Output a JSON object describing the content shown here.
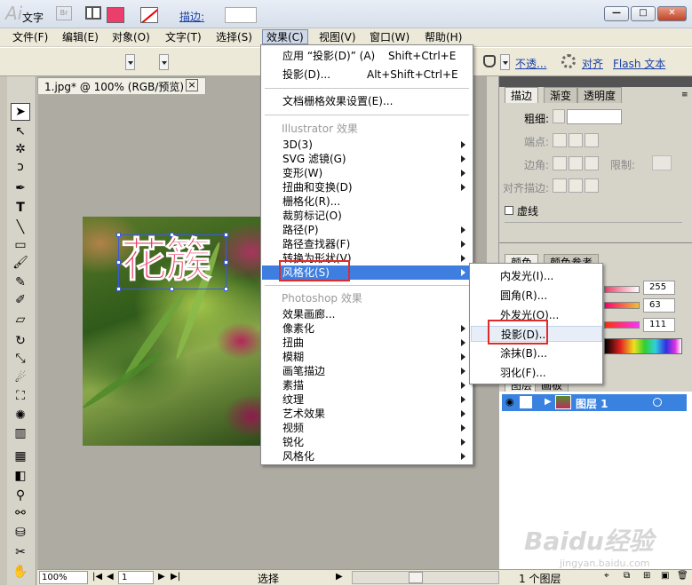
{
  "app": {
    "logo": "Ai",
    "bridge": "Br"
  },
  "window_buttons": {
    "minimize": "—",
    "restore": "□",
    "close": "✕"
  },
  "menubar": [
    "文件(F)",
    "编辑(E)",
    "对象(O)",
    "文字(T)",
    "选择(S)",
    "效果(C)",
    "视图(V)",
    "窗口(W)",
    "帮助(H)"
  ],
  "control_bar": {
    "tool_name": "文字",
    "stroke_label": "描边:",
    "opacity_label": "不透...",
    "align_label": "对齐",
    "flash_text_label": "Flash 文本"
  },
  "colors": {
    "fill": "#ec3e6a",
    "accent": "#3e7ee0",
    "highlight_box": "#e12a2a"
  },
  "document": {
    "tab_title": "1.jpg* @ 100% (RGB/预览)",
    "title_text": "花簇"
  },
  "effect_menu": {
    "apply_item": "应用 “投影(D)” (A)",
    "apply_shortcut": "Shift+Ctrl+E",
    "shadow_item": "投影(D)...",
    "shadow_shortcut": "Alt+Shift+Ctrl+E",
    "raster_settings": "文档栅格效果设置(E)...",
    "illustrator_header": "Illustrator 效果",
    "illustrator_items": [
      "3D(3)",
      "SVG 滤镜(G)",
      "变形(W)",
      "扭曲和变换(D)",
      "栅格化(R)...",
      "裁剪标记(O)",
      "路径(P)",
      "路径查找器(F)",
      "转换为形状(V)",
      "风格化(S)"
    ],
    "photoshop_header": "Photoshop 效果",
    "photoshop_items": [
      "效果画廊...",
      "像素化",
      "扭曲",
      "模糊",
      "画笔描边",
      "素描",
      "纹理",
      "艺术效果",
      "视频",
      "锐化",
      "风格化"
    ]
  },
  "stylize_submenu": [
    "内发光(I)...",
    "圆角(R)...",
    "外发光(O)...",
    "投影(D)...",
    "涂抹(B)...",
    "羽化(F)..."
  ],
  "stroke_panel": {
    "tabs": [
      "描边",
      "渐变",
      "透明度"
    ],
    "weight_label": "粗细:",
    "cap_label": "端点:",
    "corner_label": "边角:",
    "limit_label": "限制:",
    "align_stroke_label": "对齐描边:",
    "dashed_label": "虚线"
  },
  "color_panel": {
    "tabs": [
      "颜色",
      "颜色参考"
    ],
    "values": [
      "255",
      "63",
      "111"
    ]
  },
  "layers_panel": {
    "tabs": [
      "图层",
      "画板"
    ],
    "layer_name": "图层 1",
    "count_label": "1 个图层"
  },
  "status": {
    "zoom": "100%",
    "page": "1",
    "tool": "选择"
  },
  "watermark": {
    "brand": "Baidu经验",
    "url": "jingyan.baidu.com"
  }
}
